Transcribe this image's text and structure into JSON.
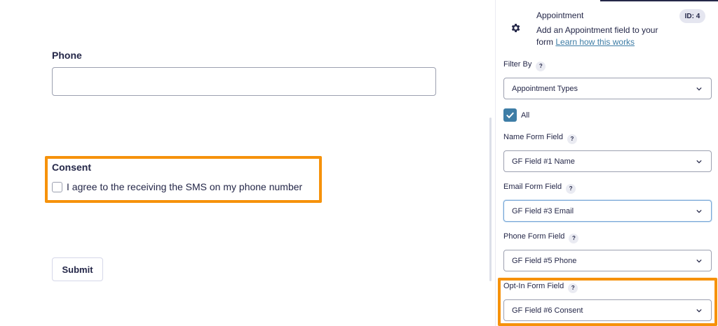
{
  "form": {
    "phone_label": "Phone",
    "phone_value": "",
    "consent_label": "Consent",
    "consent_text": "I agree to the receiving the SMS on my phone number",
    "submit_label": "Submit"
  },
  "sidebar": {
    "field_title": "Appointment",
    "field_desc": "Add an Appointment field to your form",
    "learn_link": "Learn how this works",
    "id_badge": "ID: 4",
    "help_glyph": "?",
    "filter_by": {
      "label": "Filter By",
      "value": "Appointment Types",
      "all_label": "All",
      "all_checked": true
    },
    "name_field": {
      "label": "Name Form Field",
      "value": "GF Field #1 Name"
    },
    "email_field": {
      "label": "Email Form Field",
      "value": "GF Field #3 Email"
    },
    "phone_field": {
      "label": "Phone Form Field",
      "value": "GF Field #5 Phone"
    },
    "optin_field": {
      "label": "Opt-In Form Field",
      "value": "GF Field #6 Consent"
    }
  },
  "icons": [
    "gear-icon",
    "help-icon",
    "chevron-down-icon",
    "check-icon"
  ],
  "colors": {
    "highlight": "#f6920b",
    "accent": "#3e7da6",
    "text": "#242748"
  }
}
